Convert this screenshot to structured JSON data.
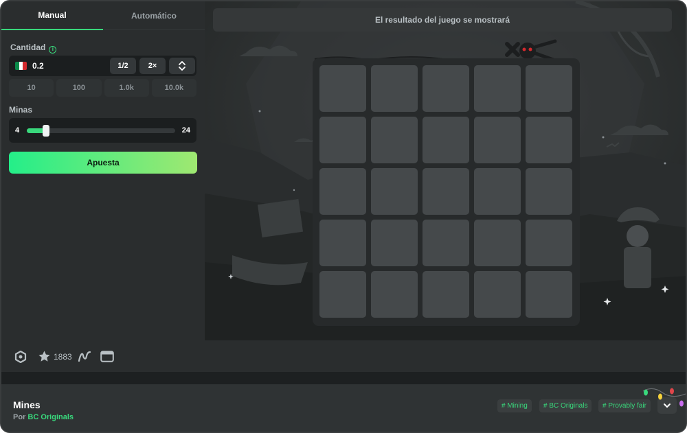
{
  "tabs": [
    {
      "label": "Manual",
      "active": true
    },
    {
      "label": "Automático",
      "active": false
    }
  ],
  "amount": {
    "label": "Cantidad",
    "value": "0.2",
    "half_label": "1/2",
    "double_label": "2×",
    "presets": [
      "10",
      "100",
      "1.0k",
      "10.0k"
    ],
    "currency_flag": "mexico-flag"
  },
  "mines": {
    "label": "Minas",
    "value": "4",
    "max": "24",
    "fraction": 0.13
  },
  "bet_button_label": "Apuesta",
  "game": {
    "result_placeholder": "El resultado del juego se mostrará",
    "grid_rows": 5,
    "grid_cols": 5
  },
  "toolbar": {
    "favorite_count": "1883",
    "icons": [
      "settings-icon",
      "star-icon",
      "graph-icon",
      "window-icon"
    ]
  },
  "info": {
    "title": "Mines",
    "by_prefix": "Por",
    "provider": "BC Originals",
    "tags": [
      "# Mining",
      "# BC Originals",
      "# Provably fair"
    ]
  },
  "colors": {
    "accent": "#39d87c",
    "bet_gradient_start": "#24ee89",
    "bet_gradient_end": "#9fe871",
    "panel": "#2a2d2e",
    "tile": "#45494b"
  }
}
